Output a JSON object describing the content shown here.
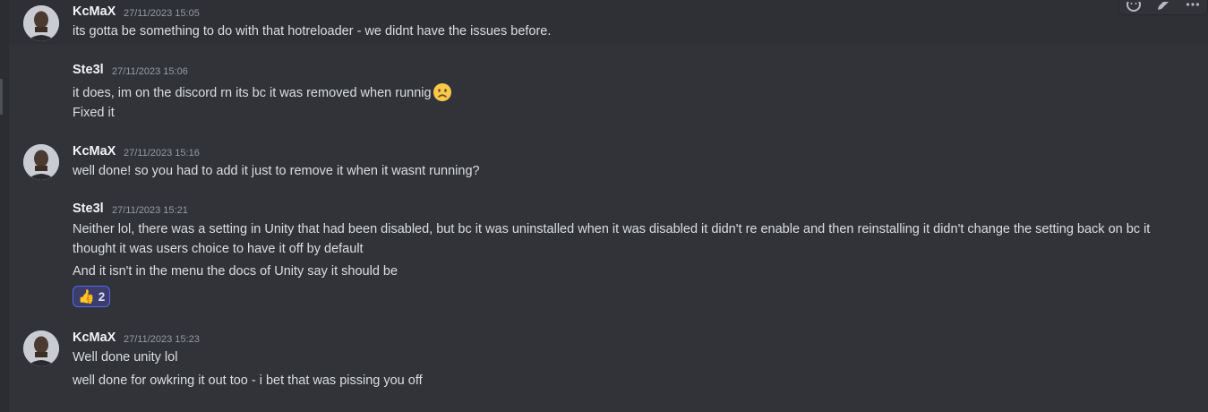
{
  "toolbar": {
    "icons": [
      "add-reaction-icon",
      "edit-icon",
      "more-options-icon"
    ]
  },
  "messages": [
    {
      "author": "KcMaX",
      "timestamp": "27/11/2023 15:05",
      "lines": [
        "its gotta be something to do with that hotreloader - we didnt have the issues before."
      ]
    },
    {
      "author": "Ste3l",
      "timestamp": "27/11/2023 15:06",
      "lines": [
        "it does, im on the discord rn its bc it was removed when runnig",
        "Fixed it"
      ],
      "emoji": "frowning-face-emoji"
    },
    {
      "author": "KcMaX",
      "timestamp": "27/11/2023 15:16",
      "lines": [
        "well done! so you had to add it just to remove it when it wasnt running?"
      ]
    },
    {
      "author": "Ste3l",
      "timestamp": "27/11/2023 15:21",
      "lines": [
        "Neither lol, there was a setting in Unity that had been disabled, but bc it was uninstalled when it was disabled it didn't re enable and then reinstalling it didn't change the setting back on bc it thought it was users choice to have it off by default",
        "And it isn't in the menu the docs of Unity say it should be"
      ],
      "reaction": {
        "emoji": "👍",
        "count": "2"
      }
    },
    {
      "author": "KcMaX",
      "timestamp": "27/11/2023 15:23",
      "lines": [
        "Well done unity lol",
        "well done for owkring it out too - i bet that was pissing you off"
      ]
    }
  ],
  "colors": {
    "background": "#313338",
    "hover_background": "#2e3035",
    "text": "#dbdee1",
    "author": "#f2f3f5",
    "timestamp": "#949ba4",
    "reaction_border": "#5865f2"
  }
}
